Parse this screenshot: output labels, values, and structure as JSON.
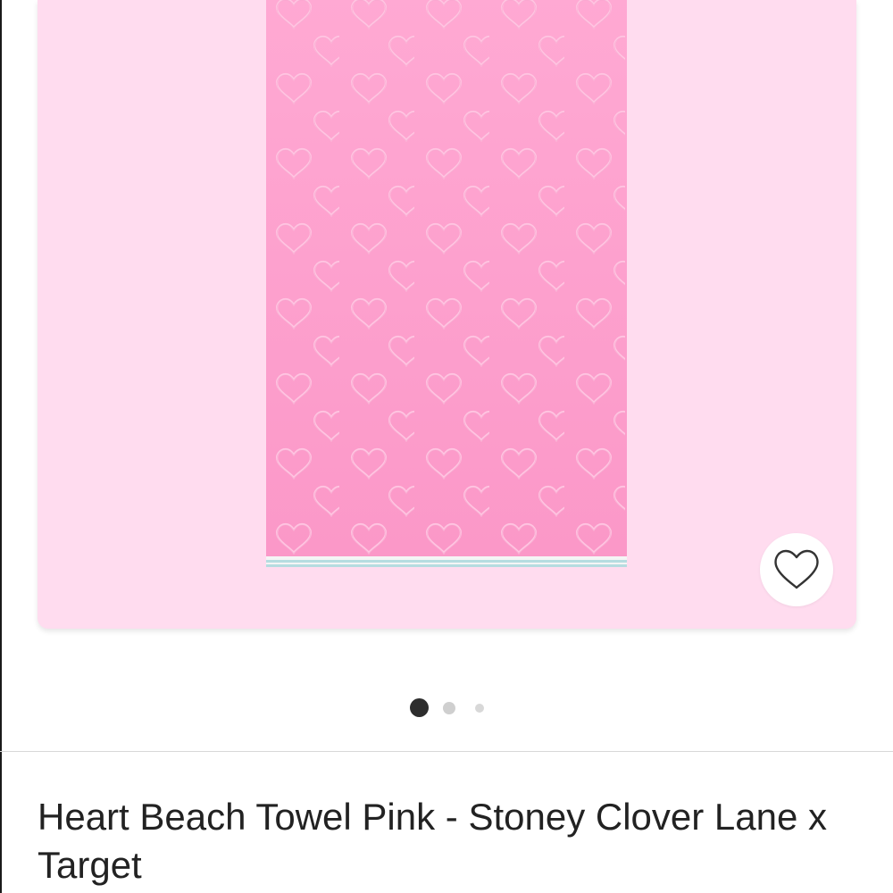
{
  "product": {
    "title": "Heart Beach Towel Pink - Stoney Clover Lane x Target",
    "image_alt": "Heart Beach Towel Pink"
  },
  "gallery": {
    "page_count": 3,
    "active_index": 0
  },
  "icons": {
    "favorite": "heart-outline-icon"
  },
  "colors": {
    "card_background": "#ffdcef",
    "towel_pink": "#fb9ccb",
    "stripe": "#b6dce0",
    "active_dot": "#2d2d2d",
    "inactive_dot": "#cfcfcf"
  }
}
